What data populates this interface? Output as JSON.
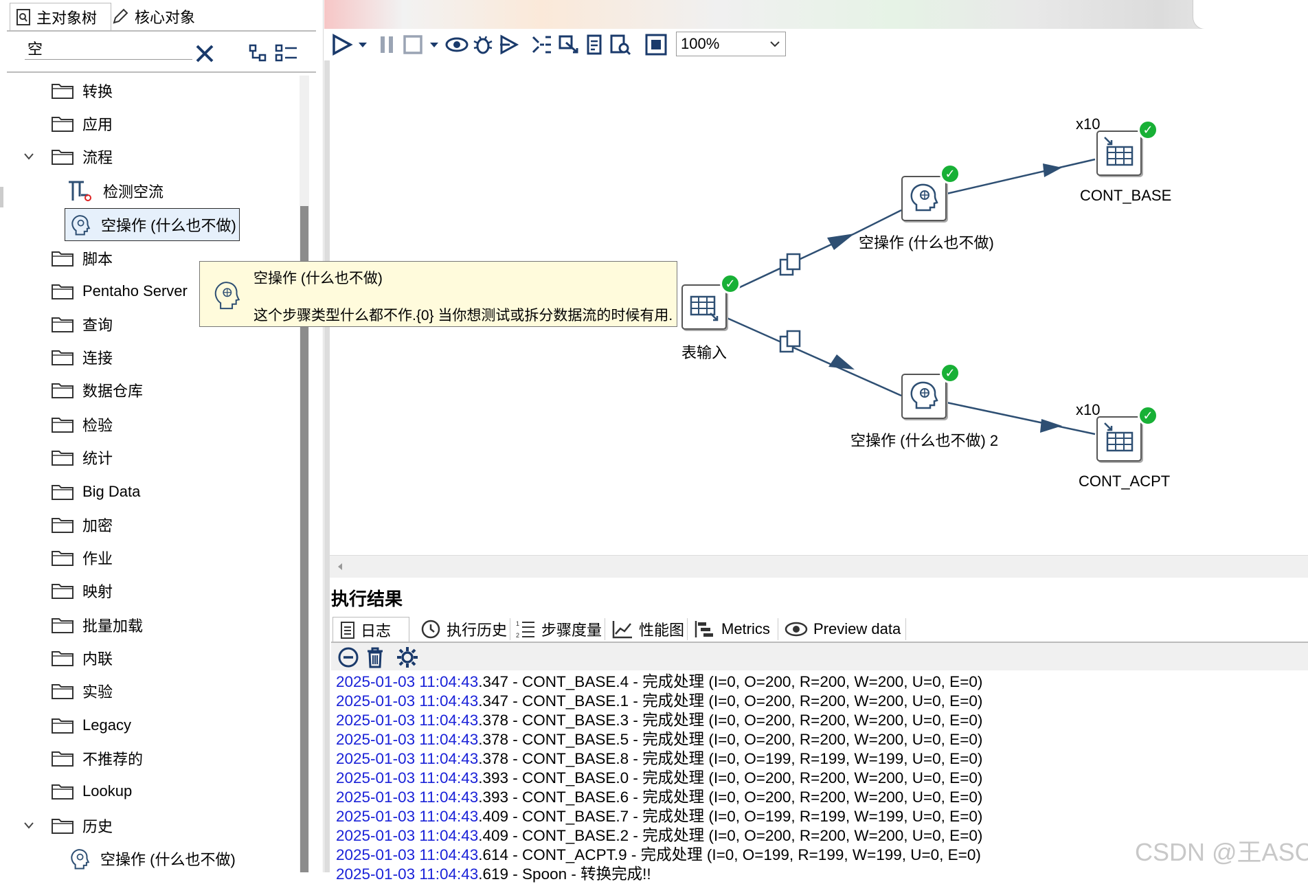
{
  "left_panel": {
    "tabs": [
      {
        "label": "主对象树"
      },
      {
        "label": "核心对象"
      }
    ],
    "search": {
      "value": "空"
    },
    "tree": [
      {
        "label": "转换",
        "type": "folder"
      },
      {
        "label": "应用",
        "type": "folder"
      },
      {
        "label": "流程",
        "type": "folder",
        "expanded": true
      },
      {
        "label": "检测空流",
        "type": "step"
      },
      {
        "label": "空操作 (什么也不做)",
        "type": "step",
        "selected": true
      },
      {
        "label": "脚本",
        "type": "folder"
      },
      {
        "label": "Pentaho Server",
        "type": "folder"
      },
      {
        "label": "查询",
        "type": "folder"
      },
      {
        "label": "连接",
        "type": "folder"
      },
      {
        "label": "数据仓库",
        "type": "folder"
      },
      {
        "label": "检验",
        "type": "folder"
      },
      {
        "label": "统计",
        "type": "folder"
      },
      {
        "label": "Big Data",
        "type": "folder"
      },
      {
        "label": "加密",
        "type": "folder"
      },
      {
        "label": "作业",
        "type": "folder"
      },
      {
        "label": "映射",
        "type": "folder"
      },
      {
        "label": "批量加载",
        "type": "folder"
      },
      {
        "label": "内联",
        "type": "folder"
      },
      {
        "label": "实验",
        "type": "folder"
      },
      {
        "label": "Legacy",
        "type": "folder"
      },
      {
        "label": "不推荐的",
        "type": "folder"
      },
      {
        "label": "Lookup",
        "type": "folder"
      },
      {
        "label": "历史",
        "type": "folder",
        "expanded": true
      },
      {
        "label": "空操作 (什么也不做)",
        "type": "step"
      }
    ]
  },
  "toolbar": {
    "zoom": "100%"
  },
  "tooltip": {
    "title": "空操作 (什么也不做)",
    "description": "这个步骤类型什么都不作.{0} 当你想测试或拆分数据流的时候有用."
  },
  "canvas": {
    "nodes": {
      "table_input": {
        "label": "表输入"
      },
      "dummy1": {
        "label": "空操作 (什么也不做)"
      },
      "dummy2": {
        "label": "空操作 (什么也不做) 2"
      },
      "cont_base": {
        "label": "CONT_BASE",
        "copies": "x10"
      },
      "cont_acpt": {
        "label": "CONT_ACPT",
        "copies": "x10"
      }
    }
  },
  "results": {
    "title": "执行结果",
    "tabs": [
      {
        "label": "日志"
      },
      {
        "label": "执行历史"
      },
      {
        "label": "步骤度量"
      },
      {
        "label": "性能图"
      },
      {
        "label": "Metrics"
      },
      {
        "label": "Preview data"
      }
    ],
    "log": [
      {
        "ts": "2025-01-03 11:04:43",
        "rest": ".347 - CONT_BASE.4 - 完成处理 (I=0, O=200, R=200, W=200, U=0, E=0)"
      },
      {
        "ts": "2025-01-03 11:04:43",
        "rest": ".347 - CONT_BASE.1 - 完成处理 (I=0, O=200, R=200, W=200, U=0, E=0)"
      },
      {
        "ts": "2025-01-03 11:04:43",
        "rest": ".378 - CONT_BASE.3 - 完成处理 (I=0, O=200, R=200, W=200, U=0, E=0)"
      },
      {
        "ts": "2025-01-03 11:04:43",
        "rest": ".378 - CONT_BASE.5 - 完成处理 (I=0, O=200, R=200, W=200, U=0, E=0)"
      },
      {
        "ts": "2025-01-03 11:04:43",
        "rest": ".378 - CONT_BASE.8 - 完成处理 (I=0, O=199, R=199, W=199, U=0, E=0)"
      },
      {
        "ts": "2025-01-03 11:04:43",
        "rest": ".393 - CONT_BASE.0 - 完成处理 (I=0, O=200, R=200, W=200, U=0, E=0)"
      },
      {
        "ts": "2025-01-03 11:04:43",
        "rest": ".393 - CONT_BASE.6 - 完成处理 (I=0, O=200, R=200, W=200, U=0, E=0)"
      },
      {
        "ts": "2025-01-03 11:04:43",
        "rest": ".409 - CONT_BASE.7 - 完成处理 (I=0, O=199, R=199, W=199, U=0, E=0)"
      },
      {
        "ts": "2025-01-03 11:04:43",
        "rest": ".409 - CONT_BASE.2 - 完成处理 (I=0, O=200, R=200, W=200, U=0, E=0)"
      },
      {
        "ts": "2025-01-03 11:04:43",
        "rest": ".614 - CONT_ACPT.9 - 完成处理 (I=0, O=199, R=199, W=199, U=0, E=0)"
      },
      {
        "ts": "2025-01-03 11:04:43",
        "rest": ".619 - Spoon - 转换完成!!"
      }
    ]
  },
  "watermark": "CSDN @王ASC"
}
